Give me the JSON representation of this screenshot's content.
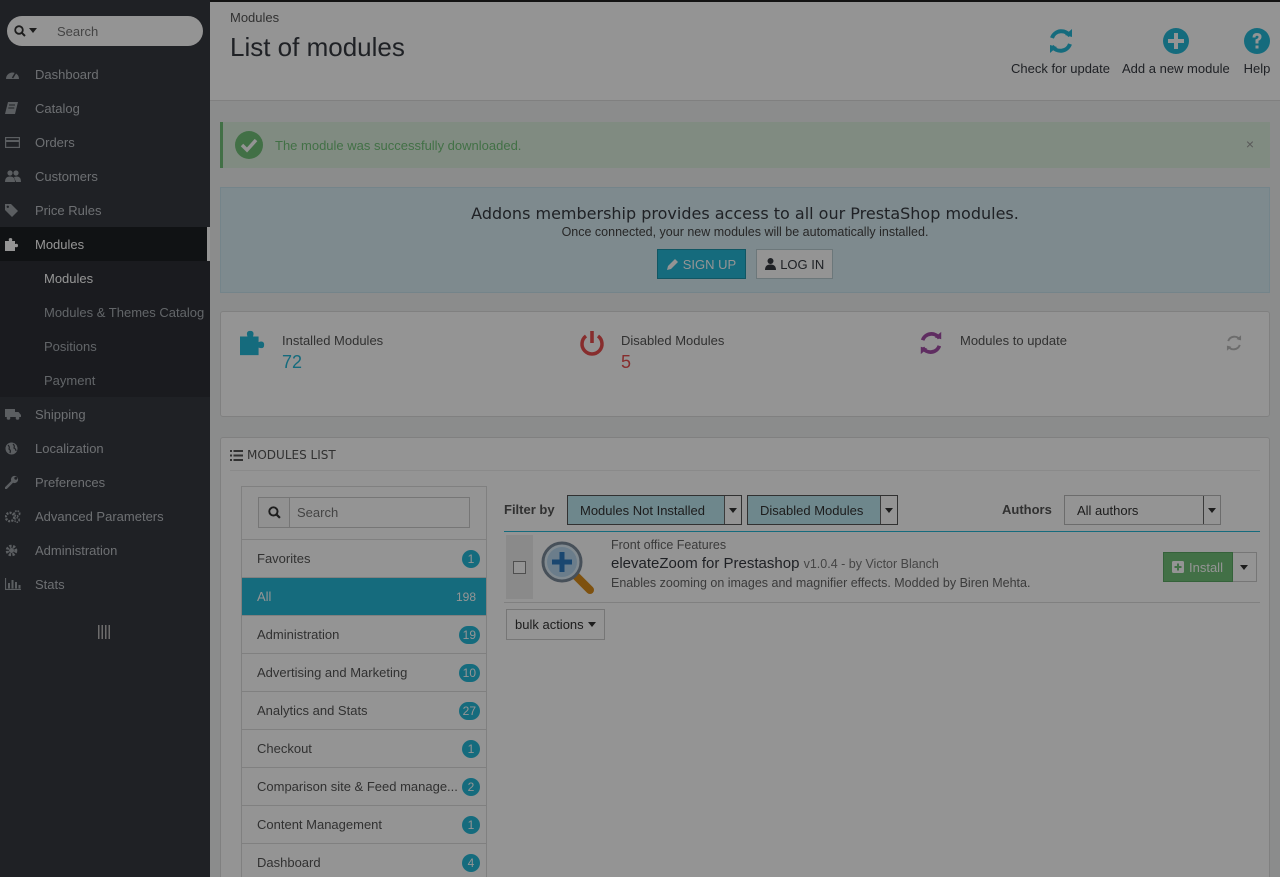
{
  "sidebar": {
    "search_placeholder": "Search",
    "items": [
      {
        "label": "Dashboard"
      },
      {
        "label": "Catalog"
      },
      {
        "label": "Orders"
      },
      {
        "label": "Customers"
      },
      {
        "label": "Price Rules"
      },
      {
        "label": "Modules"
      },
      {
        "label": "Shipping"
      },
      {
        "label": "Localization"
      },
      {
        "label": "Preferences"
      },
      {
        "label": "Advanced Parameters"
      },
      {
        "label": "Administration"
      },
      {
        "label": "Stats"
      }
    ],
    "sub_items": [
      {
        "label": "Modules"
      },
      {
        "label": "Modules & Themes Catalog"
      },
      {
        "label": "Positions"
      },
      {
        "label": "Payment"
      }
    ]
  },
  "header": {
    "breadcrumb": "Modules",
    "title": "List of modules",
    "toolbar": {
      "check_update": "Check for update",
      "add_module": "Add a new module",
      "help": "Help"
    }
  },
  "alert": {
    "message": "The module was successfully downloaded.",
    "close": "×"
  },
  "addons": {
    "title": "Addons membership provides access to all our PrestaShop modules.",
    "subtitle": "Once connected, your new modules will be automatically installed.",
    "signup": "SIGN UP",
    "login": "LOG IN"
  },
  "stats": {
    "installed": {
      "label": "Installed Modules",
      "value": "72"
    },
    "disabled": {
      "label": "Disabled Modules",
      "value": "5"
    },
    "update": {
      "label": "Modules to update"
    }
  },
  "modules_list": {
    "title": "MODULES LIST",
    "search_placeholder": "Search",
    "categories": [
      {
        "name": "Favorites",
        "count": "1"
      },
      {
        "name": "All",
        "count": "198"
      },
      {
        "name": "Administration",
        "count": "19"
      },
      {
        "name": "Advertising and Marketing",
        "count": "10"
      },
      {
        "name": "Analytics and Stats",
        "count": "27"
      },
      {
        "name": "Checkout",
        "count": "1"
      },
      {
        "name": "Comparison site & Feed manage...",
        "count": "2"
      },
      {
        "name": "Content Management",
        "count": "1"
      },
      {
        "name": "Dashboard",
        "count": "4"
      }
    ],
    "filter_label": "Filter by",
    "filter_status": "Modules Not Installed",
    "filter_enabled": "Disabled Modules",
    "authors_label": "Authors",
    "authors_value": "All authors",
    "module": {
      "category": "Front office Features",
      "name": "elevateZoom for Prestashop",
      "version": "v1.0.4 - by Victor Blanch",
      "description": "Enables zooming on images and magnifier effects. Modded by Biren Mehta.",
      "install": "Install"
    },
    "bulk_actions": "bulk actions"
  },
  "colors": {
    "accent": "#25b9d7",
    "success": "#72c279",
    "danger": "#e84e4e",
    "purple": "#a44ea8",
    "sidebar": "#363a41"
  }
}
